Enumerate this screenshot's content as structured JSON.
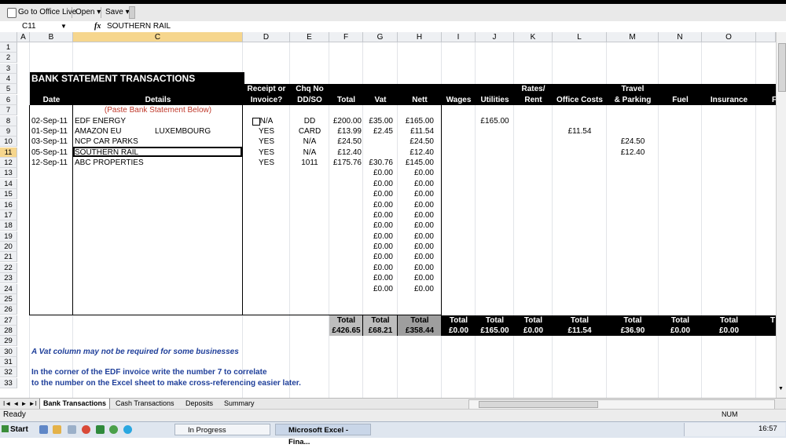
{
  "toolbar": {
    "go_office_live": "Go to Office Live",
    "open": "Open ▾",
    "save": "Save ▾"
  },
  "formula_bar": {
    "name_box": "C11",
    "fx": "fx",
    "content": "SOUTHERN RAIL"
  },
  "columns": [
    "A",
    "B",
    "C",
    "D",
    "E",
    "F",
    "G",
    "H",
    "I",
    "J",
    "K",
    "L",
    "M",
    "N",
    "O"
  ],
  "sheet": {
    "title": "BANK STATEMENT TRANSACTIONS",
    "headers": {
      "date": "Date",
      "details": "Details",
      "receipt_1": "Receipt or",
      "receipt_2": "Invoice?",
      "chq_1": "Chq No",
      "chq_2": "DD/SO",
      "total": "Total",
      "vat": "Vat",
      "nett": "Nett",
      "wages": "Wages",
      "utilities": "Utilities",
      "rates_1": "Rates/",
      "rates_2": "Rent",
      "office": "Office Costs",
      "travel_1": "Travel",
      "travel_2": "& Parking",
      "fuel": "Fuel",
      "insurance": "Insurance",
      "cut": "F"
    },
    "paste_note": "(Paste Bank Statement Below)",
    "transactions": [
      {
        "date": "02-Sep-11",
        "details": "EDF ENERGY",
        "details2": "",
        "receipt": "N/A",
        "chq": "DD",
        "total": "£200.00",
        "vat": "£35.00",
        "nett": "£165.00",
        "utilities": "£165.00",
        "office": "",
        "travel": ""
      },
      {
        "date": "01-Sep-11",
        "details": "AMAZON EU",
        "details2": "LUXEMBOURG",
        "receipt": "YES",
        "chq": "CARD",
        "total": "£13.99",
        "vat": "£2.45",
        "nett": "£11.54",
        "utilities": "",
        "office": "£11.54",
        "travel": ""
      },
      {
        "date": "03-Sep-11",
        "details": "NCP CAR PARKS",
        "details2": "",
        "receipt": "YES",
        "chq": "N/A",
        "total": "£24.50",
        "vat": "",
        "nett": "£24.50",
        "utilities": "",
        "office": "",
        "travel": "£24.50"
      },
      {
        "date": "05-Sep-11",
        "details": "SOUTHERN RAIL",
        "details2": "",
        "receipt": "YES",
        "chq": "N/A",
        "total": "£12.40",
        "vat": "",
        "nett": "£12.40",
        "utilities": "",
        "office": "",
        "travel": "£12.40"
      },
      {
        "date": "12-Sep-11",
        "details": "ABC PROPERTIES",
        "details2": "",
        "receipt": "YES",
        "chq": "1011",
        "total": "£175.76",
        "vat": "£30.76",
        "nett": "£145.00",
        "utilities": "",
        "office": "",
        "travel": ""
      }
    ],
    "zero_value": "£0.00",
    "totals_label": "Total",
    "totals": {
      "total": "£426.65",
      "vat": "£68.21",
      "nett": "£358.44",
      "wages": "£0.00",
      "utilities": "£165.00",
      "rates": "£0.00",
      "office": "£11.54",
      "travel": "£36.90",
      "fuel": "£0.00",
      "insurance": "£0.00"
    },
    "notes": {
      "vat_note": "A Vat column may not be required for some businesses",
      "edf_1": "In the corner of the EDF invoice write the number 7 to correlate",
      "edf_2": "to the number on the Excel sheet to make cross-referencing easier later."
    }
  },
  "tabs": [
    "Bank Transactions",
    "Cash Transactions",
    "Deposits",
    "Summary"
  ],
  "status": {
    "ready": "Ready",
    "num": "NUM"
  },
  "taskbar": {
    "start": "Start",
    "task1": "In Progress",
    "task2": "Microsoft Excel - Fina...",
    "clock": "16:57"
  }
}
